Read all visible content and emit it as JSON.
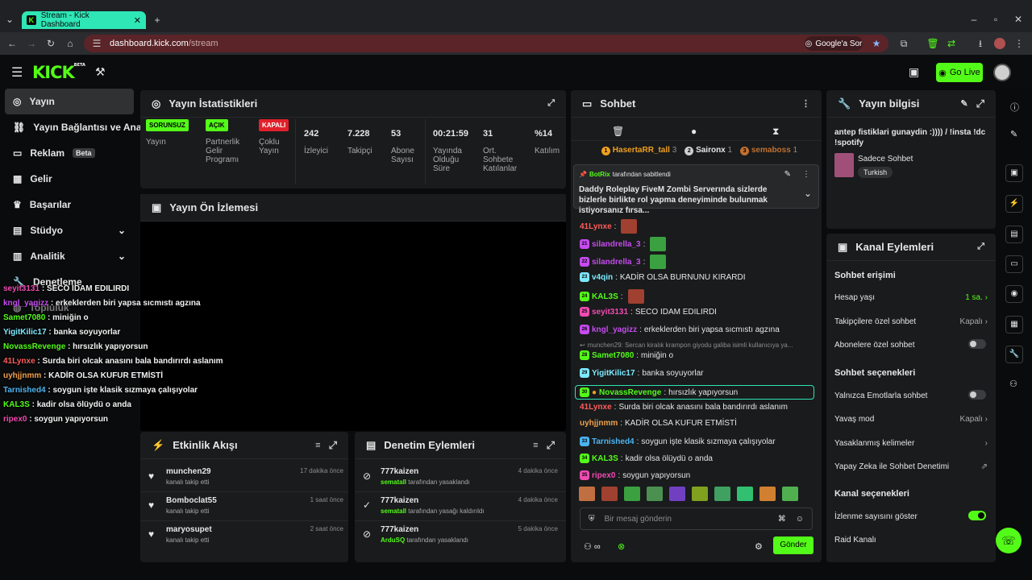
{
  "browser": {
    "tab_title": "Stream - Kick Dashboard",
    "url_host": "dashboard.kick.com",
    "url_path": "/stream",
    "google_btn": "Google'a Sor"
  },
  "topbar": {
    "logo": "KICK",
    "logo_tag": "BETA",
    "go_live": "Go Live"
  },
  "sidebar": {
    "items": [
      {
        "label": "Yayın",
        "active": true
      },
      {
        "label": "Yayın Bağlantısı ve Anahtar"
      },
      {
        "label": "Reklam",
        "badge": "Beta"
      },
      {
        "label": "Gelir"
      },
      {
        "label": "Başarılar"
      },
      {
        "label": "Stüdyo"
      },
      {
        "label": "Analitik"
      },
      {
        "label": "Denetleme"
      },
      {
        "label": "Topluluk"
      }
    ]
  },
  "stats": {
    "title": "Yayın İstatistikleri",
    "items": [
      {
        "badge": "SORUNSUZ",
        "label": "Yayın"
      },
      {
        "badge": "AÇIK",
        "label": "Partnerlik Gelir Programı"
      },
      {
        "badge": "KAPALI",
        "label": "Çoklu Yayın"
      },
      {
        "value": "242",
        "label": "İzleyici"
      },
      {
        "value": "7.228",
        "label": "Takipçi"
      },
      {
        "value": "53",
        "label": "Abone Sayısı"
      },
      {
        "value": "00:21:59",
        "label": "Yayında Olduğu Süre"
      },
      {
        "value": "31",
        "label": "Ort. Sohbete Katılanlar"
      },
      {
        "value": "%14",
        "label": "Katılım"
      }
    ]
  },
  "preview": {
    "title": "Yayın Ön İzlemesi",
    "overlay": [
      {
        "user": "seyit3131",
        "msg": "SECO IDAM EDILIRDI",
        "color": "#f04bb2"
      },
      {
        "user": "kngl_yagizz",
        "msg": "erkeklerden biri yapsa sıcmıstı agzına",
        "color": "#c64bf0"
      },
      {
        "user": "Samet7080",
        "msg": "miniğin o",
        "color": "#53fc18"
      },
      {
        "user": "YigitKilic17",
        "msg": "banka soyuyorlar",
        "color": "#7de8ff"
      },
      {
        "user": "NovassRevenge",
        "msg": "hırsızlık yapıyorsun",
        "color": "#53fc18"
      },
      {
        "user": "41Lynxe",
        "msg": "Surda biri olcak anasını bala bandırırdı aslanım",
        "color": "#ff5c5c"
      },
      {
        "user": "uyhjjnmm",
        "msg": "KADİR OLSA KUFUR ETMİSTİ",
        "color": "#f0a04b"
      },
      {
        "user": "Tarnished4",
        "msg": "soygun işte klasik sızmaya çalışıyolar",
        "color": "#4bb4f0"
      },
      {
        "user": "KAL3S",
        "msg": "kadir olsa ölüydü o anda",
        "color": "#53fc18"
      },
      {
        "user": "ripex0",
        "msg": "soygun yapıyorsun",
        "color": "#f04bb2"
      }
    ]
  },
  "activity": {
    "title": "Etkinlik Akışı",
    "rows": [
      {
        "user": "munchen29",
        "sub": "kanalı takip etti",
        "time": "17 dakika önce"
      },
      {
        "user": "Bomboclat55",
        "sub": "kanalı takip etti",
        "time": "1 saat önce"
      },
      {
        "user": "maryosupet",
        "sub": "kanalı takip etti",
        "time": "2 saat önce"
      }
    ]
  },
  "moderation": {
    "title": "Denetim Eylemleri",
    "rows": [
      {
        "user": "777kaizen",
        "by": "sematall",
        "sub": "tarafından yasaklandı",
        "time": "4 dakika önce"
      },
      {
        "user": "777kaizen",
        "by": "sematall",
        "sub": "tarafından yasağı kaldırıldı",
        "time": "4 dakika önce"
      },
      {
        "user": "777kaizen",
        "by": "ArduSQ",
        "sub": "tarafından yasaklandı",
        "time": "5 dakika önce"
      }
    ]
  },
  "chat": {
    "title": "Sohbet",
    "top": [
      {
        "rank": "1",
        "name": "HasertaRR_tall",
        "n": "3"
      },
      {
        "rank": "2",
        "name": "Saironx",
        "n": "1"
      },
      {
        "rank": "3",
        "name": "semaboss",
        "n": "1"
      }
    ],
    "pinned": {
      "by": "BotRix",
      "by_suffix": "tarafından sabitlendi",
      "text": "Daddy Roleplay FiveM Zombi Serverında sizlerde bizlerle birlikte rol yapma deneyiminde bulunmak istiyorsanız fırsa..."
    },
    "messages": [
      {
        "user": "41Lynxe",
        "msg": "",
        "color": "#ff5c5c"
      },
      {
        "user": "silandrella_3",
        "msg": "",
        "color": "#c64bf0"
      },
      {
        "user": "silandrella_3",
        "msg": "",
        "color": "#c64bf0"
      },
      {
        "user": "v4qin",
        "msg": "KADİR OLSA BURNUNU KIRARDI",
        "color": "#7de8ff"
      },
      {
        "user": "KAL3S",
        "msg": "",
        "color": "#53fc18"
      },
      {
        "user": "seyit3131",
        "msg": "SECO IDAM EDILIRDI",
        "color": "#f04bb2"
      },
      {
        "user": "kngl_yagizz",
        "msg": "erkeklerden biri yapsa sıcmıstı agzına",
        "color": "#c64bf0"
      },
      {
        "user": "",
        "msg": "munchen29: Sercan kiralık krampon giyodu galiba isimli kullanıcıya ya...",
        "color": "#8d8d8d",
        "reply": true
      },
      {
        "user": "Samet7080",
        "msg": "miniğin o",
        "color": "#53fc18"
      },
      {
        "user": "YigitKilic17",
        "msg": "banka soyuyorlar",
        "color": "#7de8ff"
      },
      {
        "user": "NovassRevenge",
        "msg": "hırsızlık yapıyorsun",
        "color": "#53fc18",
        "highlight": true
      },
      {
        "user": "41Lynxe",
        "msg": "Surda biri olcak anasını bala bandırırdı aslanım",
        "color": "#ff5c5c"
      },
      {
        "user": "uyhjjnmm",
        "msg": "KADİR OLSA KUFUR ETMİSTİ",
        "color": "#f0a04b"
      },
      {
        "user": "Tarnished4",
        "msg": "soygun işte klasik sızmaya çalışıyolar",
        "color": "#4bb4f0"
      },
      {
        "user": "KAL3S",
        "msg": "kadir olsa ölüydü o anda",
        "color": "#53fc18"
      },
      {
        "user": "ripex0",
        "msg": "soygun yapıyorsun",
        "color": "#f04bb2"
      }
    ],
    "placeholder": "Bir mesaj gönderin",
    "send": "Gönder"
  },
  "info": {
    "title": "Yayın bilgisi",
    "stream_title": "antep fistiklari gunaydin :)))) / !insta !dc !spotify",
    "category": "Sadece Sohbet",
    "language": "Turkish"
  },
  "channel": {
    "title": "Kanal Eylemleri",
    "chat_access": {
      "heading": "Sohbet erişimi",
      "account_age_label": "Hesap yaşı",
      "account_age_value": "1 sa.",
      "followers_only_label": "Takipçilere özel sohbet",
      "followers_only_value": "Kapalı",
      "subs_only_label": "Abonelere özel sohbet"
    },
    "chat_options": {
      "heading": "Sohbet seçenekleri",
      "emote_only_label": "Yalnızca Emotlarla sohbet",
      "slow_mode_label": "Yavaş mod",
      "slow_mode_value": "Kapalı",
      "banned_words_label": "Yasaklanmış kelimeler",
      "ai_mod_label": "Yapay Zeka ile Sohbet Denetimi"
    },
    "channel_options": {
      "heading": "Kanal seçenekleri",
      "viewer_count_label": "İzlenme sayısını göster",
      "raid_label": "Raid Kanalı"
    }
  },
  "colors": {
    "accent": "#53fc18",
    "panel": "#191b1c",
    "bg": "#0a0b0c"
  }
}
